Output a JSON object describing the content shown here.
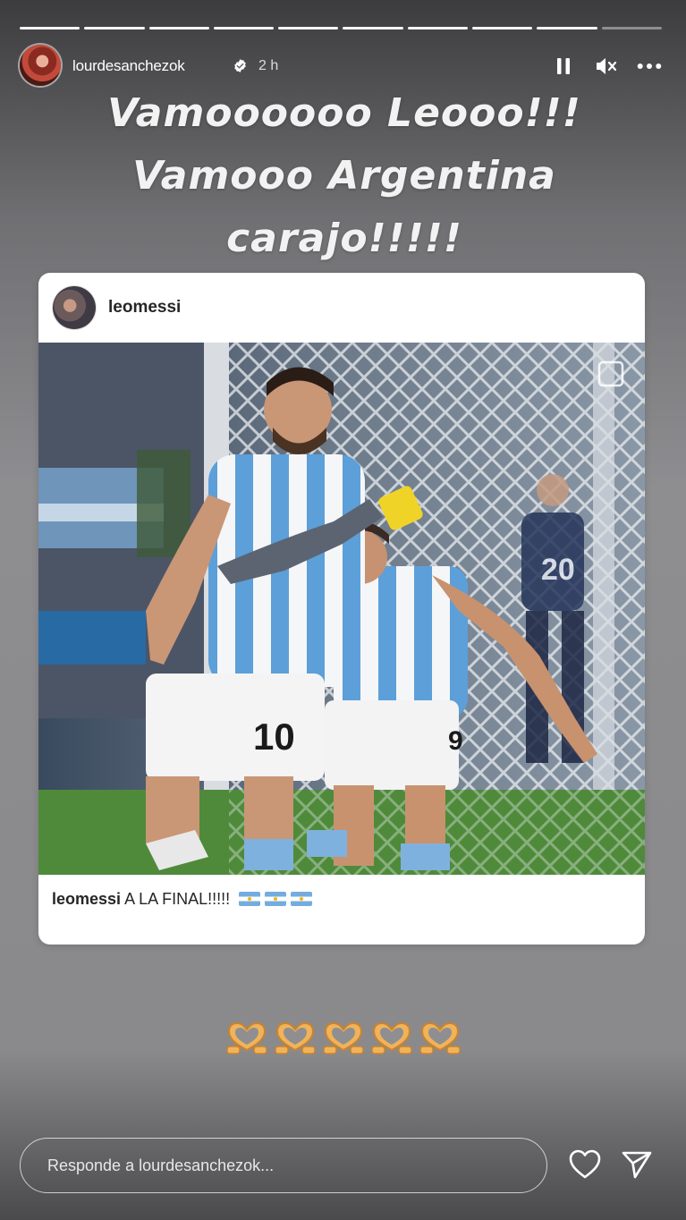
{
  "story": {
    "progress": {
      "total_segments": 10,
      "current_segment": 9
    },
    "username": "lourdesanchezok",
    "verified": true,
    "time": "2 h",
    "controls": [
      "pause-icon",
      "muted-speaker-icon",
      "more-options-icon"
    ],
    "text_lines": [
      "Vamoooooo Leooo!!!",
      "Vamooo Argentina",
      "carajo!!!!!"
    ]
  },
  "post": {
    "author": "leomessi",
    "caption_user": "leomessi",
    "caption_text": "A LA FINAL!!!!!",
    "caption_flags": 3,
    "photo_jersey_numbers": [
      "10",
      "9",
      "20"
    ]
  },
  "reactions": {
    "emoji": "heart-hands",
    "count": 5
  },
  "reply": {
    "placeholder": "Responde a lourdesanchezok...",
    "like_icon": "heart-icon",
    "send_icon": "send-icon"
  },
  "colors": {
    "argentina_blue": "#74acdf",
    "verified_blue": "#ffffff",
    "card_bg": "#ffffff"
  }
}
